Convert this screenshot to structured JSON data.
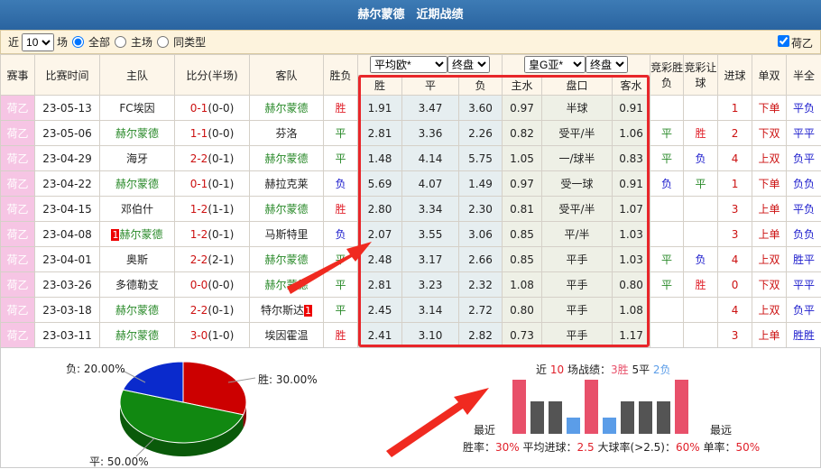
{
  "title": "赫尔蒙德　近期战绩",
  "filter": {
    "prefix": "近",
    "count": "10",
    "suffix": "场",
    "opts": [
      "全部",
      "主场",
      "同类型"
    ],
    "league_check": "荷乙"
  },
  "headers": {
    "league": "赛事",
    "time": "比赛时间",
    "home": "主队",
    "score": "比分(半场)",
    "away": "客队",
    "result": "胜负",
    "eu_company": "平均欧*",
    "eu_type": "终盘",
    "as_company": "皇G亚*",
    "as_type": "终盘",
    "w": "胜",
    "d": "平",
    "l": "负",
    "hw": "主水",
    "hcp": "盘口",
    "aw": "客水",
    "jc_res": "竞彩胜负",
    "jc_hcp": "竞彩让球",
    "goals": "进球",
    "oe": "单双",
    "hf": "半全"
  },
  "rows": [
    {
      "lg": "荷乙",
      "t": "23-05-13",
      "h": "FC埃因",
      "hg": false,
      "s": "0-1",
      "hs": "(0-0)",
      "a": "赫尔蒙德",
      "ag": true,
      "r": "胜",
      "w": "1.91",
      "d": "3.47",
      "l": "3.60",
      "hw": "0.97",
      "hcp": "半球",
      "aw": "0.91",
      "jr": "",
      "jh": "",
      "g": "1",
      "oe": "下单",
      "hf": "平负"
    },
    {
      "lg": "荷乙",
      "t": "23-05-06",
      "h": "赫尔蒙德",
      "hg": true,
      "s": "1-1",
      "hs": "(0-0)",
      "a": "芬洛",
      "ag": false,
      "r": "平",
      "w": "2.81",
      "d": "3.36",
      "l": "2.26",
      "hw": "0.82",
      "hcp": "受平/半",
      "aw": "1.06",
      "jr": "平",
      "jh": "胜",
      "g": "2",
      "oe": "下双",
      "hf": "平平"
    },
    {
      "lg": "荷乙",
      "t": "23-04-29",
      "h": "海牙",
      "hg": false,
      "s": "2-2",
      "hs": "(0-1)",
      "a": "赫尔蒙德",
      "ag": true,
      "r": "平",
      "w": "1.48",
      "d": "4.14",
      "l": "5.75",
      "hw": "1.05",
      "hcp": "一/球半",
      "aw": "0.83",
      "jr": "平",
      "jh": "负",
      "g": "4",
      "oe": "上双",
      "hf": "负平"
    },
    {
      "lg": "荷乙",
      "t": "23-04-22",
      "h": "赫尔蒙德",
      "hg": true,
      "s": "0-1",
      "hs": "(0-1)",
      "a": "赫拉克莱",
      "ag": false,
      "r": "负",
      "w": "5.69",
      "d": "4.07",
      "l": "1.49",
      "hw": "0.97",
      "hcp": "受一球",
      "aw": "0.91",
      "jr": "负",
      "jh": "平",
      "g": "1",
      "oe": "下单",
      "hf": "负负"
    },
    {
      "lg": "荷乙",
      "t": "23-04-15",
      "h": "邓伯什",
      "hg": false,
      "s": "1-2",
      "hs": "(1-1)",
      "a": "赫尔蒙德",
      "ag": true,
      "r": "胜",
      "w": "2.80",
      "d": "3.34",
      "l": "2.30",
      "hw": "0.81",
      "hcp": "受平/半",
      "aw": "1.07",
      "jr": "",
      "jh": "",
      "g": "3",
      "oe": "上单",
      "hf": "平负"
    },
    {
      "lg": "荷乙",
      "t": "23-04-08",
      "h": "赫尔蒙德",
      "hg": true,
      "hc": "1",
      "s": "1-2",
      "hs": "(0-1)",
      "a": "马斯特里",
      "ag": false,
      "r": "负",
      "w": "2.07",
      "d": "3.55",
      "l": "3.06",
      "hw": "0.85",
      "hcp": "平/半",
      "aw": "1.03",
      "jr": "",
      "jh": "",
      "g": "3",
      "oe": "上单",
      "hf": "负负"
    },
    {
      "lg": "荷乙",
      "t": "23-04-01",
      "h": "奥斯",
      "hg": false,
      "s": "2-2",
      "hs": "(2-1)",
      "a": "赫尔蒙德",
      "ag": true,
      "r": "平",
      "w": "2.48",
      "d": "3.17",
      "l": "2.66",
      "hw": "0.85",
      "hcp": "平手",
      "aw": "1.03",
      "jr": "平",
      "jh": "负",
      "g": "4",
      "oe": "上双",
      "hf": "胜平"
    },
    {
      "lg": "荷乙",
      "t": "23-03-26",
      "h": "多德勒支",
      "hg": false,
      "s": "0-0",
      "hs": "(0-0)",
      "a": "赫尔蒙德",
      "ag": true,
      "r": "平",
      "w": "2.81",
      "d": "3.23",
      "l": "2.32",
      "hw": "1.08",
      "hcp": "平手",
      "aw": "0.80",
      "jr": "平",
      "jh": "胜",
      "g": "0",
      "oe": "下双",
      "hf": "平平"
    },
    {
      "lg": "荷乙",
      "t": "23-03-18",
      "h": "赫尔蒙德",
      "hg": true,
      "s": "2-2",
      "hs": "(0-1)",
      "a": "特尔斯达",
      "ag": false,
      "ac": "1",
      "r": "平",
      "w": "2.45",
      "d": "3.14",
      "l": "2.72",
      "hw": "0.80",
      "hcp": "平手",
      "aw": "1.08",
      "jr": "",
      "jh": "",
      "g": "4",
      "oe": "上双",
      "hf": "负平"
    },
    {
      "lg": "荷乙",
      "t": "23-03-11",
      "h": "赫尔蒙德",
      "hg": true,
      "s": "3-0",
      "hs": "(1-0)",
      "a": "埃因霍温",
      "ag": false,
      "r": "胜",
      "w": "2.41",
      "d": "3.10",
      "l": "2.82",
      "hw": "0.73",
      "hcp": "平手",
      "aw": "1.17",
      "jr": "",
      "jh": "",
      "g": "3",
      "oe": "上单",
      "hf": "胜胜"
    }
  ],
  "pie": {
    "win_label": "胜: 30.00%",
    "draw_label": "平: 50.00%",
    "loss_label": "负: 20.00%",
    "win": 30,
    "draw": 50,
    "loss": 20,
    "colors": {
      "win": "#cc0000",
      "draw": "#118811",
      "loss": "#0a2acc"
    }
  },
  "summary": {
    "p1": "近",
    "n": "10",
    "p2": "场战绩：",
    "w": "3胜",
    "d": "5平",
    "l": "2负",
    "recent": "最近",
    "oldest": "最远",
    "stats": [
      {
        "k": "胜率：",
        "v": "30%"
      },
      {
        "k": "平均进球：",
        "v": "2.5"
      },
      {
        "k": "大球率(>2.5)：",
        "v": "60%"
      },
      {
        "k": "单率：",
        "v": "50%"
      }
    ]
  },
  "bars": [
    "胜",
    "平",
    "平",
    "负",
    "胜",
    "负",
    "平",
    "平",
    "平",
    "胜"
  ],
  "bar_colors": {
    "胜": "#e8506a",
    "平": "#545454",
    "负": "#5b9de8"
  }
}
